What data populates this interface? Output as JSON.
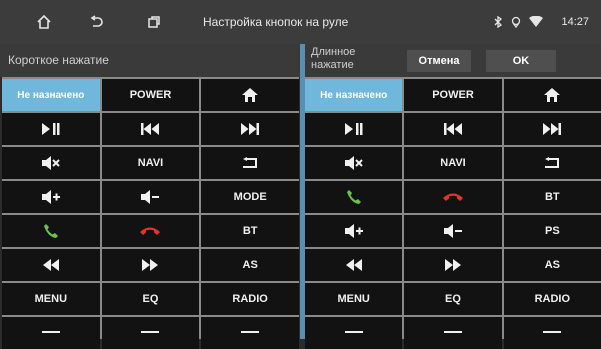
{
  "statusbar": {
    "title": "Настройка кнопок на руле",
    "time": "14:27",
    "icons": [
      "home-icon",
      "back-icon",
      "recent-apps-icon"
    ],
    "status_icons": [
      "bluetooth-icon",
      "location-icon",
      "wifi-icon"
    ]
  },
  "left_panel": {
    "header": "Короткое нажатие",
    "cells": [
      {
        "label": "Не назначено",
        "icon": null,
        "selected": true
      },
      {
        "label": "POWER",
        "icon": null
      },
      {
        "label": "",
        "icon": "home-icon"
      },
      {
        "label": "",
        "icon": "play-pause-icon"
      },
      {
        "label": "",
        "icon": "previous-track-icon"
      },
      {
        "label": "",
        "icon": "next-track-icon"
      },
      {
        "label": "",
        "icon": "mute-icon"
      },
      {
        "label": "NAVI",
        "icon": null
      },
      {
        "label": "",
        "icon": "return-icon"
      },
      {
        "label": "",
        "icon": "volume-up-icon"
      },
      {
        "label": "",
        "icon": "volume-down-icon"
      },
      {
        "label": "MODE",
        "icon": null
      },
      {
        "label": "",
        "icon": "call-accept-icon"
      },
      {
        "label": "",
        "icon": "call-end-icon"
      },
      {
        "label": "BT",
        "icon": null
      },
      {
        "label": "",
        "icon": "rewind-icon"
      },
      {
        "label": "",
        "icon": "fast-forward-icon"
      },
      {
        "label": "AS",
        "icon": null
      },
      {
        "label": "MENU",
        "icon": null
      },
      {
        "label": "EQ",
        "icon": null
      },
      {
        "label": "RADIO",
        "icon": null
      },
      {
        "label": "",
        "icon": "more-icon"
      },
      {
        "label": "",
        "icon": "more-icon"
      },
      {
        "label": "",
        "icon": "more-icon"
      }
    ]
  },
  "right_panel": {
    "header": "Длинное нажатие",
    "cancel_label": "Отмена",
    "ok_label": "OK",
    "cells": [
      {
        "label": "Не назначено",
        "icon": null,
        "selected": true
      },
      {
        "label": "POWER",
        "icon": null
      },
      {
        "label": "",
        "icon": "home-icon"
      },
      {
        "label": "",
        "icon": "play-pause-icon"
      },
      {
        "label": "",
        "icon": "previous-track-icon"
      },
      {
        "label": "",
        "icon": "next-track-icon"
      },
      {
        "label": "",
        "icon": "mute-icon"
      },
      {
        "label": "NAVI",
        "icon": null
      },
      {
        "label": "",
        "icon": "return-icon"
      },
      {
        "label": "",
        "icon": "call-accept-icon"
      },
      {
        "label": "",
        "icon": "call-end-icon"
      },
      {
        "label": "BT",
        "icon": null
      },
      {
        "label": "",
        "icon": "volume-up-icon"
      },
      {
        "label": "",
        "icon": "volume-down-icon"
      },
      {
        "label": "PS",
        "icon": null
      },
      {
        "label": "",
        "icon": "rewind-icon"
      },
      {
        "label": "",
        "icon": "fast-forward-icon"
      },
      {
        "label": "AS",
        "icon": null
      },
      {
        "label": "MENU",
        "icon": null
      },
      {
        "label": "EQ",
        "icon": null
      },
      {
        "label": "RADIO",
        "icon": null
      },
      {
        "label": "",
        "icon": "more-icon"
      },
      {
        "label": "",
        "icon": "more-icon"
      },
      {
        "label": "",
        "icon": "more-icon"
      }
    ]
  },
  "colors": {
    "accent": "#6fb8dc",
    "call_accept": "#6cc24a",
    "call_end": "#e0342e",
    "divider": "#5a8fb5"
  }
}
